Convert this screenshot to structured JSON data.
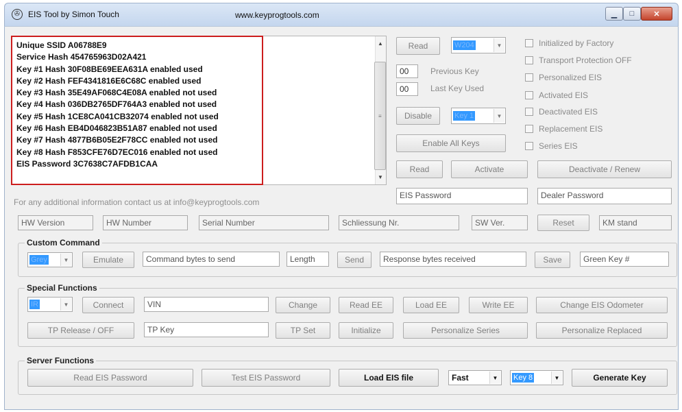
{
  "window": {
    "title": "EIS Tool by Simon Touch",
    "url": "www.keyprogtools.com",
    "controls": {
      "minimize": "▁",
      "maximize": "□",
      "close": "✕"
    }
  },
  "info_lines": [
    "Unique  SSID  A06788E9",
    "Service Hash  454765963D02A421",
    "Key #1 Hash  30F08BE69EEA631A  enabled  used",
    "Key #2 Hash  FEF4341816E6C68C  enabled  used",
    "Key #3 Hash  35E49AF068C4E08A  enabled  not used",
    "Key #4 Hash  036DB2765DF764A3  enabled  not used",
    "Key #5 Hash  1CE8CA041CB32074  enabled  not used",
    "Key #6 Hash  EB4D046823B51A87  enabled  not used",
    "Key #7 Hash  4877B6B05E2F78CC  enabled  not used",
    "Key #8 Hash  F853CFE76D7EC016  enabled  not used",
    "EIS Password  3C7638C7AFDB1CAA"
  ],
  "top_right": {
    "read_label": "Read",
    "model_select": "W204",
    "previous_key_value": "00",
    "previous_key_label": "Previous Key",
    "last_key_value": "00",
    "last_key_label": "Last Key Used",
    "disable_label": "Disable",
    "key_select": "Key 1",
    "enable_all_label": "Enable All Keys",
    "read2_label": "Read",
    "activate_label": "Activate",
    "deactivate_label": "Deactivate / Renew",
    "eis_password_field": "EIS Password",
    "dealer_password_field": "Dealer Password"
  },
  "status_checks": [
    "Initialized by Factory",
    "Transport Protection OFF",
    "Personalized EIS",
    "Activated EIS",
    "Deactivated EIS",
    "Replacement EIS",
    "Series EIS"
  ],
  "contact_text": "For any additional information contact us at info@keyprogtools.com",
  "hw_row": {
    "hw_version": "HW Version",
    "hw_number": "HW Number",
    "serial_number": "Serial Number",
    "schliessung": "Schliessung Nr.",
    "sw_ver": "SW Ver.",
    "reset": "Reset",
    "km_stand": "KM stand"
  },
  "custom_command": {
    "title": "Custom Command",
    "mode_select": "Grey",
    "emulate": "Emulate",
    "command_field": "Command bytes to send",
    "length_field": "Length",
    "send": "Send",
    "response_field": "Response bytes received",
    "save": "Save",
    "green_key_field": "Green Key #"
  },
  "special_functions": {
    "title": "Special Functions",
    "port_select": "IR",
    "connect": "Connect",
    "vin_field": "VIN",
    "change": "Change",
    "read_ee": "Read EE",
    "load_ee": "Load EE",
    "write_ee": "Write EE",
    "change_odometer": "Change EIS Odometer",
    "tp_release": "TP Release / OFF",
    "tp_key_field": "TP Key",
    "tp_set": "TP Set",
    "initialize": "Initialize",
    "personalize_series": "Personalize Series",
    "personalize_replaced": "Personalize Replaced"
  },
  "server_functions": {
    "title": "Server Functions",
    "read_eis_password": "Read EIS Password",
    "test_eis_password": "Test EIS Password",
    "load_eis_file": "Load EIS file",
    "speed_select": "Fast",
    "key_select": "Key 8",
    "generate_key": "Generate Key"
  },
  "colors": {
    "accent_red": "#cc1d1d",
    "selection_blue": "#3399ff",
    "window_bg": "#f0f0f0"
  }
}
